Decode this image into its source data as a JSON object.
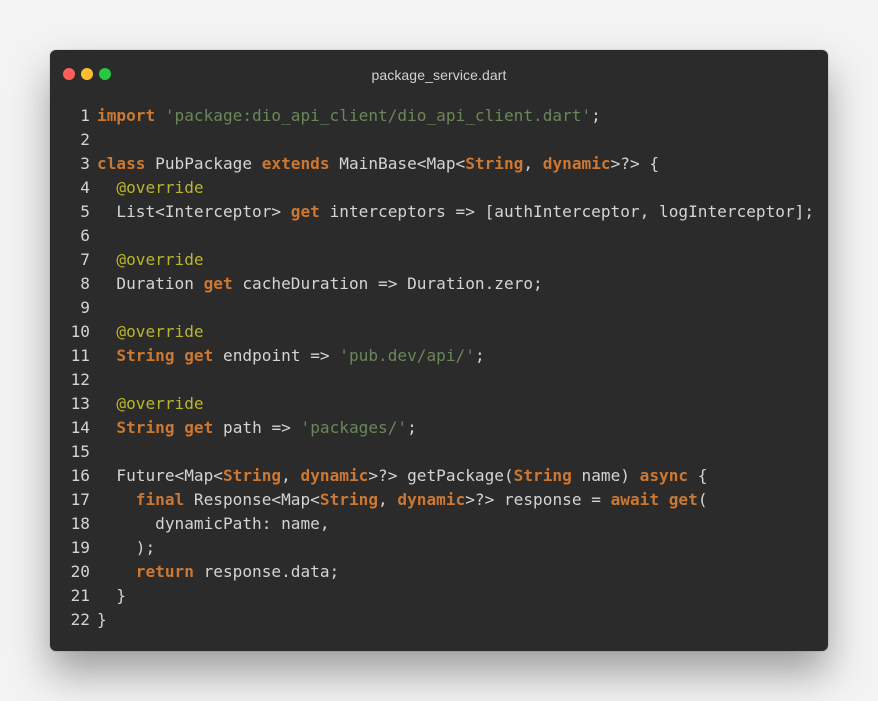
{
  "window": {
    "title": "package_service.dart"
  },
  "code": {
    "lines": [
      {
        "n": "1",
        "tokens": [
          {
            "t": "import",
            "k": "keyword"
          },
          {
            "t": " ",
            "k": "plain"
          },
          {
            "t": "'package:dio_api_client/dio_api_client.dart'",
            "k": "string"
          },
          {
            "t": ";",
            "k": "plain"
          }
        ]
      },
      {
        "n": "2",
        "tokens": []
      },
      {
        "n": "3",
        "tokens": [
          {
            "t": "class",
            "k": "keyword"
          },
          {
            "t": " PubPackage ",
            "k": "plain"
          },
          {
            "t": "extends",
            "k": "keyword"
          },
          {
            "t": " MainBase<Map<",
            "k": "plain"
          },
          {
            "t": "String",
            "k": "keyword"
          },
          {
            "t": ", ",
            "k": "plain"
          },
          {
            "t": "dynamic",
            "k": "keyword"
          },
          {
            "t": ">?> {",
            "k": "plain"
          }
        ]
      },
      {
        "n": "4",
        "tokens": [
          {
            "t": "  ",
            "k": "plain"
          },
          {
            "t": "@override",
            "k": "annotation"
          }
        ]
      },
      {
        "n": "5",
        "tokens": [
          {
            "t": "  List<Interceptor> ",
            "k": "plain"
          },
          {
            "t": "get",
            "k": "keyword"
          },
          {
            "t": " interceptors => [authInterceptor, logInterceptor];",
            "k": "plain"
          }
        ]
      },
      {
        "n": "6",
        "tokens": []
      },
      {
        "n": "7",
        "tokens": [
          {
            "t": "  ",
            "k": "plain"
          },
          {
            "t": "@override",
            "k": "annotation"
          }
        ]
      },
      {
        "n": "8",
        "tokens": [
          {
            "t": "  Duration ",
            "k": "plain"
          },
          {
            "t": "get",
            "k": "keyword"
          },
          {
            "t": " cacheDuration => Duration.zero;",
            "k": "plain"
          }
        ]
      },
      {
        "n": "9",
        "tokens": []
      },
      {
        "n": "10",
        "tokens": [
          {
            "t": "  ",
            "k": "plain"
          },
          {
            "t": "@override",
            "k": "annotation"
          }
        ]
      },
      {
        "n": "11",
        "tokens": [
          {
            "t": "  ",
            "k": "plain"
          },
          {
            "t": "String",
            "k": "keyword"
          },
          {
            "t": " ",
            "k": "plain"
          },
          {
            "t": "get",
            "k": "keyword"
          },
          {
            "t": " endpoint => ",
            "k": "plain"
          },
          {
            "t": "'pub.dev/api/'",
            "k": "string"
          },
          {
            "t": ";",
            "k": "plain"
          }
        ]
      },
      {
        "n": "12",
        "tokens": []
      },
      {
        "n": "13",
        "tokens": [
          {
            "t": "  ",
            "k": "plain"
          },
          {
            "t": "@override",
            "k": "annotation"
          }
        ]
      },
      {
        "n": "14",
        "tokens": [
          {
            "t": "  ",
            "k": "plain"
          },
          {
            "t": "String",
            "k": "keyword"
          },
          {
            "t": " ",
            "k": "plain"
          },
          {
            "t": "get",
            "k": "keyword"
          },
          {
            "t": " path => ",
            "k": "plain"
          },
          {
            "t": "'packages/'",
            "k": "string"
          },
          {
            "t": ";",
            "k": "plain"
          }
        ]
      },
      {
        "n": "15",
        "tokens": []
      },
      {
        "n": "16",
        "tokens": [
          {
            "t": "  Future<Map<",
            "k": "plain"
          },
          {
            "t": "String",
            "k": "keyword"
          },
          {
            "t": ", ",
            "k": "plain"
          },
          {
            "t": "dynamic",
            "k": "keyword"
          },
          {
            "t": ">?> getPackage(",
            "k": "plain"
          },
          {
            "t": "String",
            "k": "keyword"
          },
          {
            "t": " name) ",
            "k": "plain"
          },
          {
            "t": "async",
            "k": "keyword"
          },
          {
            "t": " {",
            "k": "plain"
          }
        ]
      },
      {
        "n": "17",
        "tokens": [
          {
            "t": "    ",
            "k": "plain"
          },
          {
            "t": "final",
            "k": "keyword"
          },
          {
            "t": " Response<Map<",
            "k": "plain"
          },
          {
            "t": "String",
            "k": "keyword"
          },
          {
            "t": ", ",
            "k": "plain"
          },
          {
            "t": "dynamic",
            "k": "keyword"
          },
          {
            "t": ">?> response = ",
            "k": "plain"
          },
          {
            "t": "await",
            "k": "keyword"
          },
          {
            "t": " ",
            "k": "plain"
          },
          {
            "t": "get",
            "k": "keyword"
          },
          {
            "t": "(",
            "k": "plain"
          }
        ]
      },
      {
        "n": "18",
        "tokens": [
          {
            "t": "      dynamicPath: name,",
            "k": "plain"
          }
        ]
      },
      {
        "n": "19",
        "tokens": [
          {
            "t": "    );",
            "k": "plain"
          }
        ]
      },
      {
        "n": "20",
        "tokens": [
          {
            "t": "    ",
            "k": "plain"
          },
          {
            "t": "return",
            "k": "keyword"
          },
          {
            "t": " response.data;",
            "k": "plain"
          }
        ]
      },
      {
        "n": "21",
        "tokens": [
          {
            "t": "  }",
            "k": "plain"
          }
        ]
      },
      {
        "n": "22",
        "tokens": [
          {
            "t": "}",
            "k": "plain"
          }
        ]
      }
    ]
  }
}
